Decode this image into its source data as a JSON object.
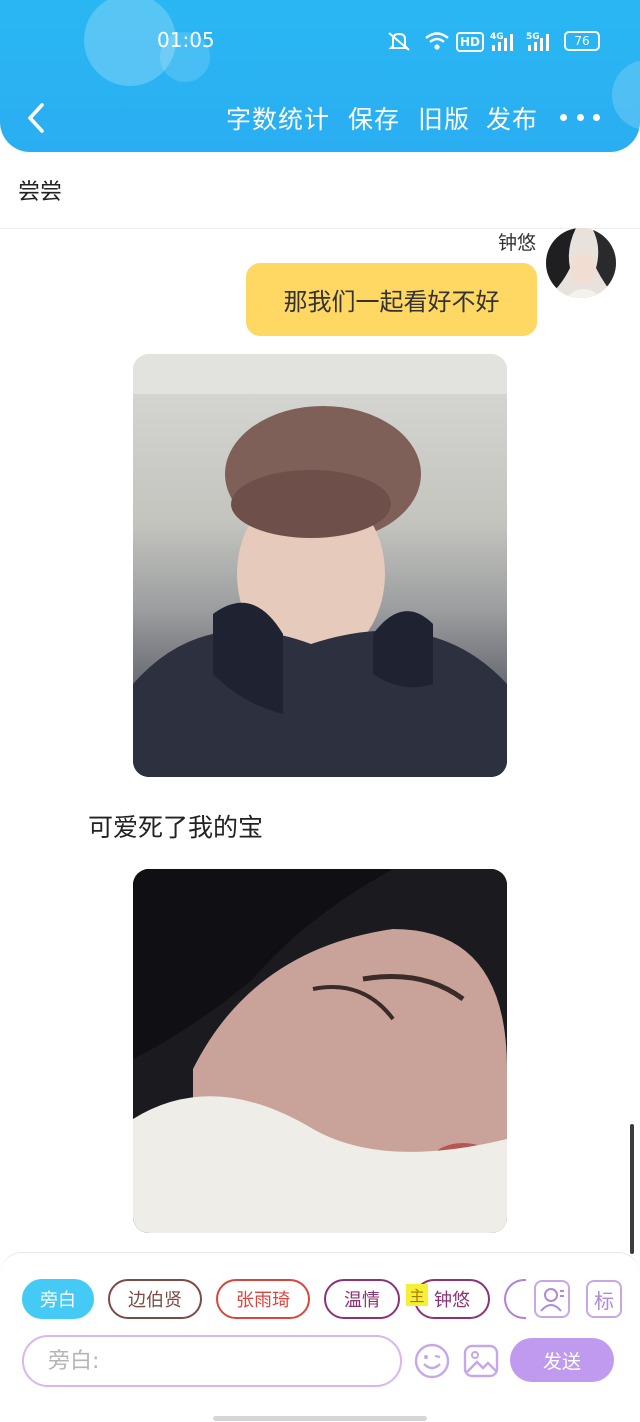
{
  "status_bar": {
    "time": "01:05",
    "network_hd": "HD",
    "network_4g": "4G",
    "network_5g": "5G",
    "battery": "76"
  },
  "nav": {
    "word_count_label": "字数统计",
    "save_label": "保存",
    "old_version_label": "旧版",
    "publish_label": "发布"
  },
  "story": {
    "title": "尝尝"
  },
  "chat": {
    "speaker_name": "钟悠",
    "message": "那我们一起看好不好",
    "narration": "可爱死了我的宝"
  },
  "roles": {
    "narration": "旁白",
    "baek": "边伯贤",
    "zhang": "张雨琦",
    "wen": "温情",
    "zhong": "钟悠",
    "main_badge": "主"
  },
  "tools": {
    "tag_label": "标"
  },
  "composer": {
    "placeholder": "旁白:",
    "send_label": "发送"
  },
  "colors": {
    "header": "#2aaef2",
    "bubble": "#ffd863",
    "narration_chip": "#45c9f5",
    "send_button": "#c09aef"
  },
  "icons": {
    "back": "chevron-left-icon",
    "more": "more-dots-icon",
    "mute": "mute-bell-icon",
    "wifi": "wifi-icon",
    "role": "person-icon",
    "emoji": "smiley-icon",
    "image": "image-icon"
  }
}
